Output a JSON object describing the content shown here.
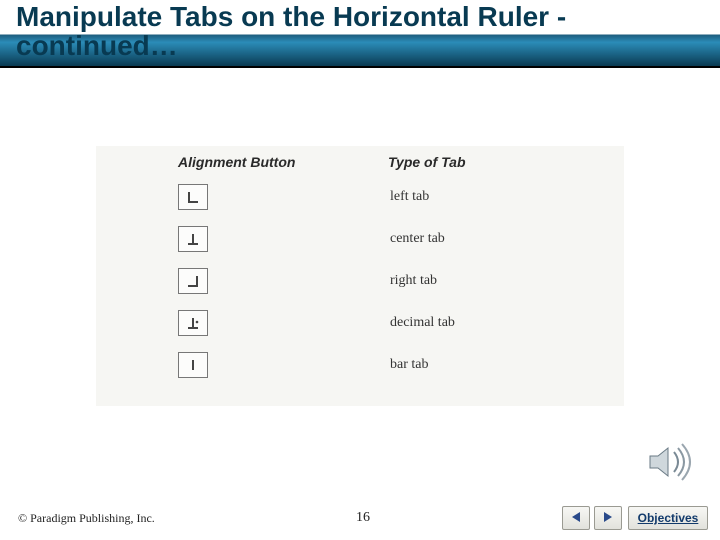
{
  "header": {
    "title": "Manipulate Tabs on the Horizontal Ruler - continued…"
  },
  "table": {
    "col1_header": "Alignment Button",
    "col2_header": "Type of Tab",
    "rows": [
      {
        "icon": "left-tab-icon",
        "label": "left tab"
      },
      {
        "icon": "center-tab-icon",
        "label": "center tab"
      },
      {
        "icon": "right-tab-icon",
        "label": "right tab"
      },
      {
        "icon": "decimal-tab-icon",
        "label": "decimal tab"
      },
      {
        "icon": "bar-tab-icon",
        "label": "bar tab"
      }
    ]
  },
  "footer": {
    "copyright": "© Paradigm Publishing, Inc.",
    "page_number": "16",
    "objectives_label": "Objectives"
  }
}
